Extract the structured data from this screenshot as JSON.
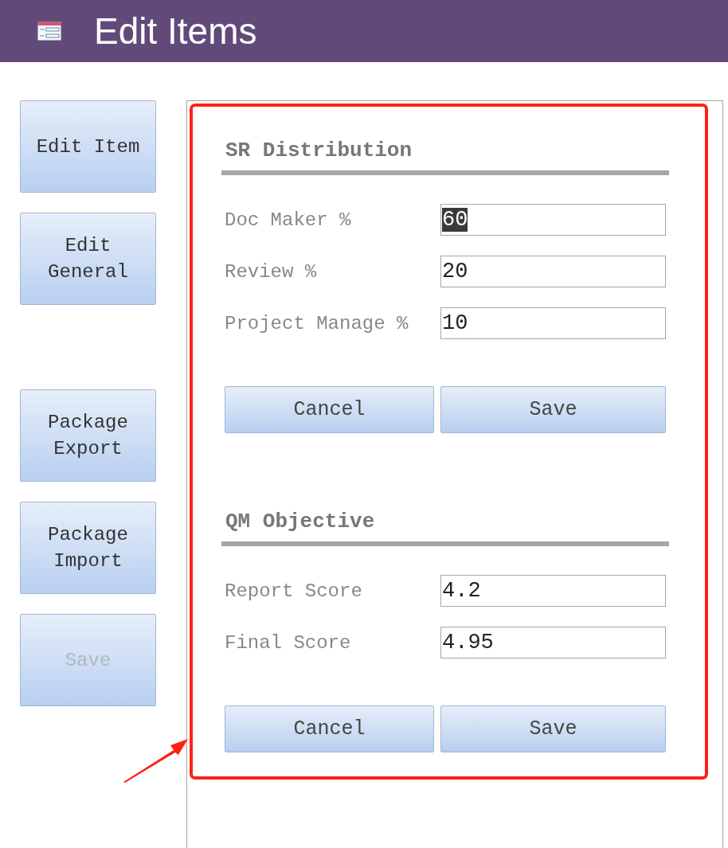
{
  "header": {
    "title": "Edit Items"
  },
  "sidebar": {
    "groups": [
      [
        {
          "label": "Edit Item",
          "disabled": false
        },
        {
          "label": "Edit\nGeneral",
          "disabled": false
        }
      ],
      [
        {
          "label": "Package\nExport",
          "disabled": false
        },
        {
          "label": "Package\nImport",
          "disabled": false
        },
        {
          "label": "Save",
          "disabled": true
        }
      ]
    ]
  },
  "sections": [
    {
      "title": "SR Distribution",
      "fields": [
        {
          "label": "Doc Maker %",
          "value": "60",
          "selected": true
        },
        {
          "label": "Review %",
          "value": "20",
          "selected": false
        },
        {
          "label": "Project Manage %",
          "value": "10",
          "selected": false
        }
      ],
      "buttons": [
        "Cancel",
        "Save"
      ]
    },
    {
      "title": "QM Objective",
      "fields": [
        {
          "label": "Report Score",
          "value": "4.2",
          "selected": false
        },
        {
          "label": "Final Score",
          "value": "4.95",
          "selected": false
        }
      ],
      "buttons": [
        "Cancel",
        "Save"
      ]
    }
  ]
}
